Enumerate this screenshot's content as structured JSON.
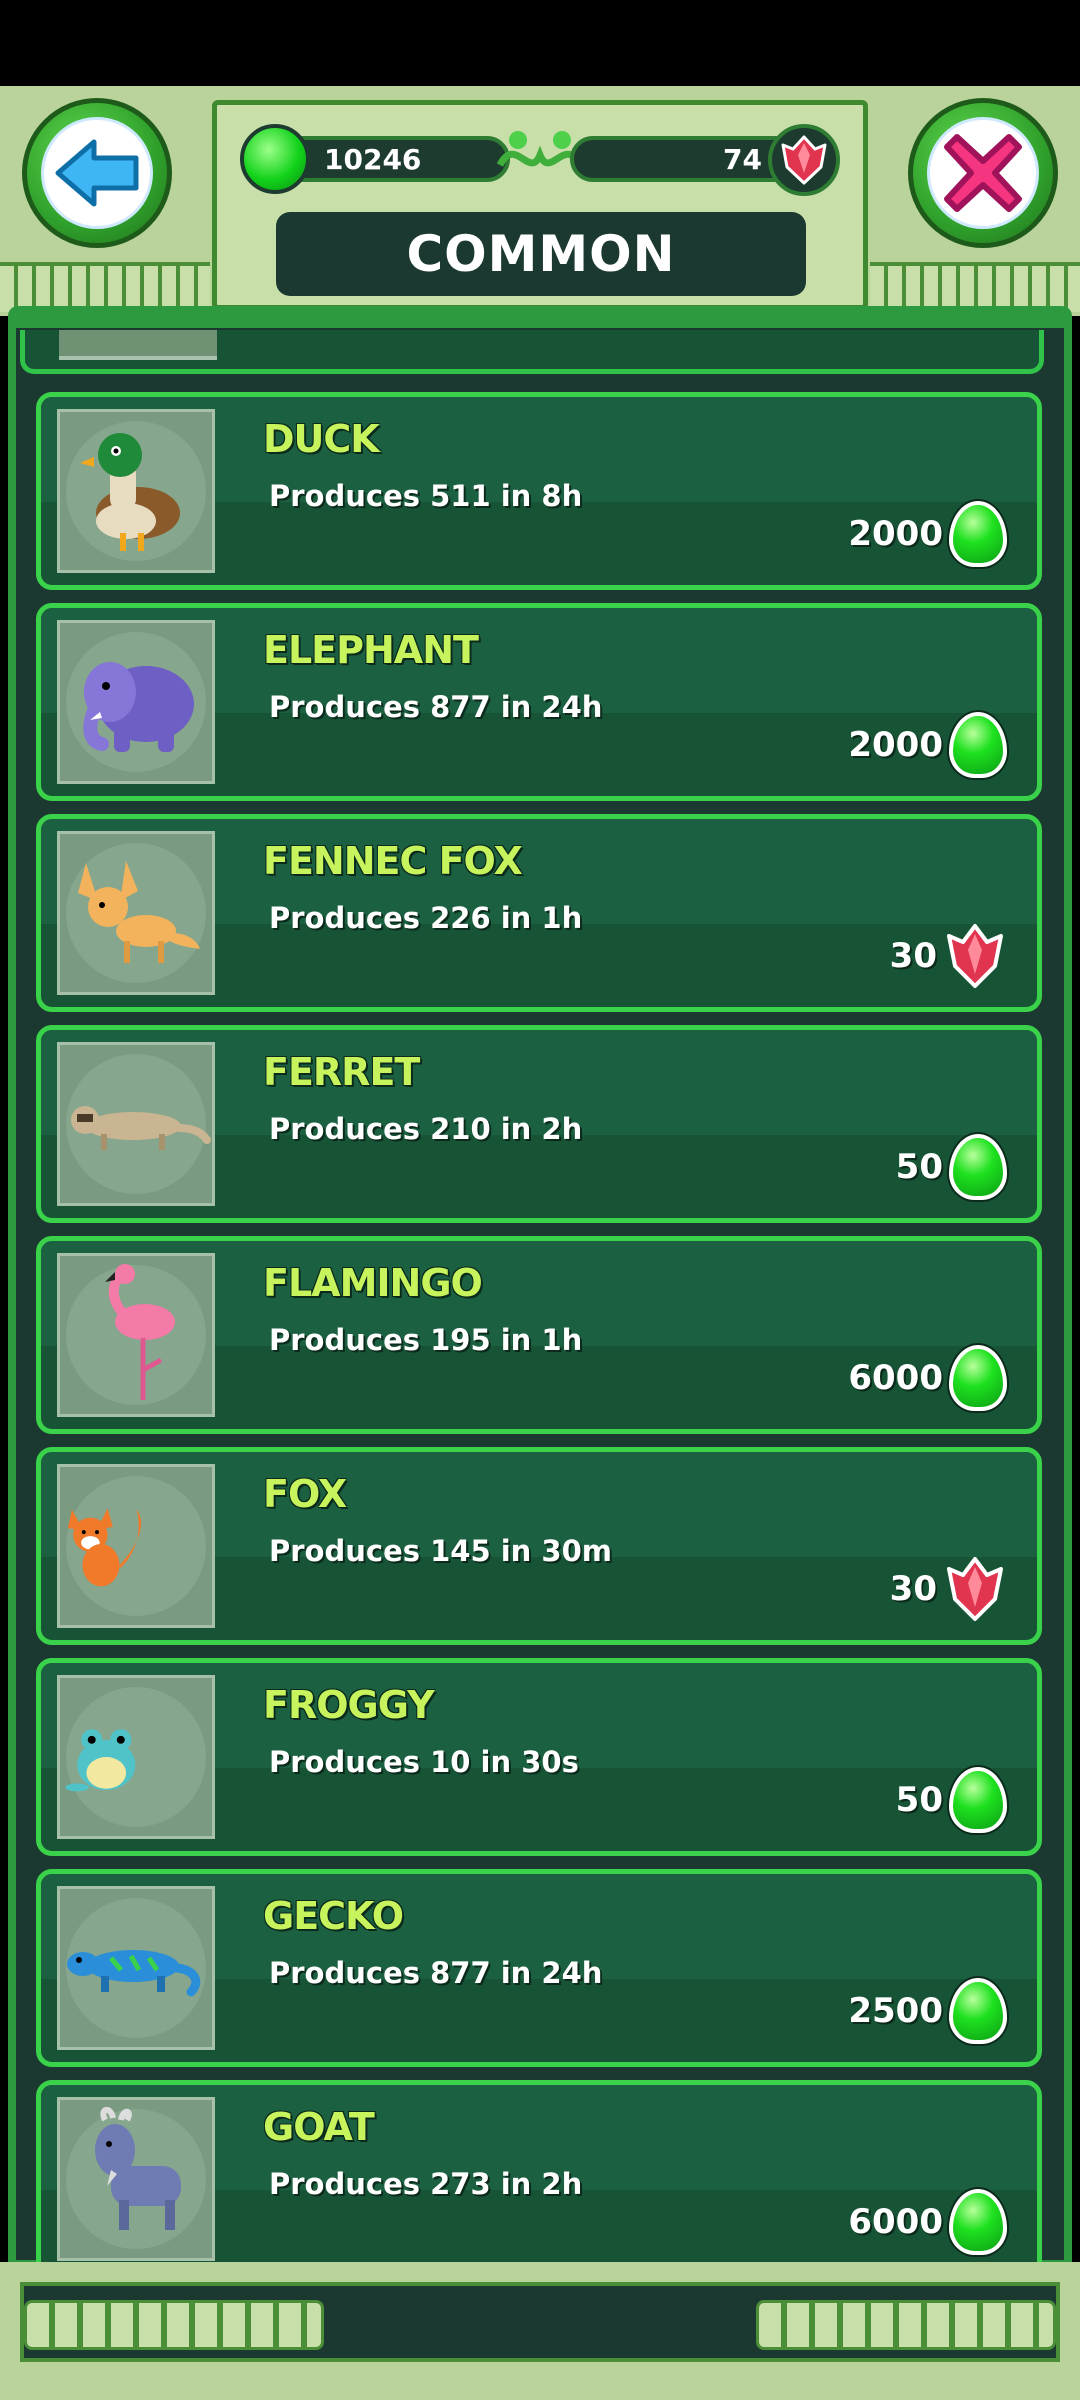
{
  "header": {
    "title": "COMMON",
    "jelly_count": "10246",
    "crystal_count": "74",
    "back_icon": "back-arrow-icon",
    "close_icon": "close-x-icon"
  },
  "animals": [
    {
      "name": "DUCK",
      "produces": "Produces 511 in 8h",
      "price": "2000",
      "currency": "jelly",
      "owned": false
    },
    {
      "name": "ELEPHANT",
      "produces": "Produces 877 in 24h",
      "price": "2000",
      "currency": "jelly",
      "owned": false
    },
    {
      "name": "FENNEC FOX",
      "produces": "Produces 226 in 1h",
      "price": "30",
      "currency": "crystal",
      "owned": false
    },
    {
      "name": "FERRET",
      "produces": "Produces 210 in 2h",
      "price": "50",
      "currency": "jelly",
      "owned": false
    },
    {
      "name": "FLAMINGO",
      "produces": "Produces 195 in 1h",
      "price": "6000",
      "currency": "jelly",
      "owned": false
    },
    {
      "name": "FOX",
      "produces": "Produces 145 in 30m",
      "price": "30",
      "currency": "crystal",
      "owned": true
    },
    {
      "name": "FROGGY",
      "produces": "Produces 10 in 30s",
      "price": "50",
      "currency": "jelly",
      "owned": true
    },
    {
      "name": "GECKO",
      "produces": "Produces 877 in 24h",
      "price": "2500",
      "currency": "jelly",
      "owned": false
    },
    {
      "name": "GOAT",
      "produces": "Produces 273 in 2h",
      "price": "6000",
      "currency": "jelly",
      "owned": false
    }
  ],
  "colors": {
    "jelly": "#1ee11f",
    "crystal": "#e0344f",
    "name_text": "#c7f45c",
    "card_border": "#3ad24a"
  }
}
